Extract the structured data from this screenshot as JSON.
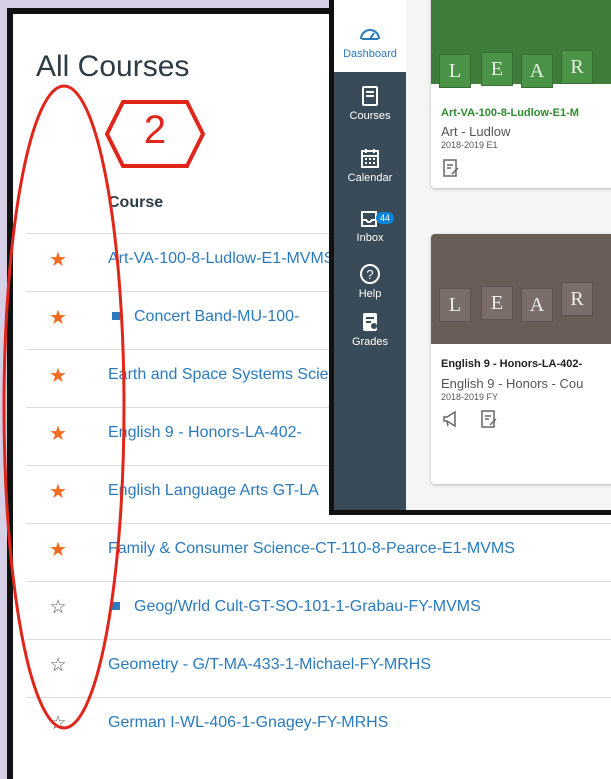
{
  "page": {
    "title": "All Courses",
    "column_header": "Course"
  },
  "annotation": {
    "number": "2"
  },
  "courses": [
    {
      "name": "Art-VA-100-8-Ludlow-E1-MVMS",
      "favorited": true,
      "square": false
    },
    {
      "name": "Concert Band-MU-100-",
      "favorited": true,
      "square": true
    },
    {
      "name": "Earth and Space Systems Science-SC",
      "favorited": true,
      "square": false
    },
    {
      "name": "English 9 - Honors-LA-402-",
      "favorited": true,
      "square": false
    },
    {
      "name": "English Language Arts GT-LA",
      "favorited": true,
      "square": false
    },
    {
      "name": "Family & Consumer Science-CT-110-8-Pearce-E1-MVMS",
      "favorited": true,
      "square": false
    },
    {
      "name": "Geog/Wrld Cult-GT-SO-101-1-Grabau-FY-MVMS",
      "favorited": false,
      "square": true
    },
    {
      "name": "Geometry - G/T-MA-433-1-Michael-FY-MRHS",
      "favorited": false,
      "square": false
    },
    {
      "name": "German I-WL-406-1-Gnagey-FY-MRHS",
      "favorited": false,
      "square": false
    }
  ],
  "nav": {
    "dashboard": "Dashboard",
    "courses": "Courses",
    "calendar": "Calendar",
    "inbox": "Inbox",
    "inbox_count": "44",
    "help": "Help",
    "grades": "Grades"
  },
  "cards": [
    {
      "title": "Art-VA-100-8-Ludlow-E1-M",
      "subtitle": "Art - Ludlow",
      "term": "2018-2019 E1",
      "title_color": "#2e8b2e",
      "tiles": [
        "L",
        "E",
        "A",
        "R"
      ]
    },
    {
      "title": "English 9 - Honors-LA-402-",
      "subtitle": "English 9 - Honors - Cou",
      "term": "2018-2019 FY",
      "title_color": "#222222",
      "tiles": [
        "L",
        "E",
        "A",
        "R"
      ]
    }
  ],
  "colors": {
    "accent": "#2b7abc",
    "star": "#f46a1f",
    "annotation": "#e0261b",
    "nav_bg": "#394b58"
  }
}
